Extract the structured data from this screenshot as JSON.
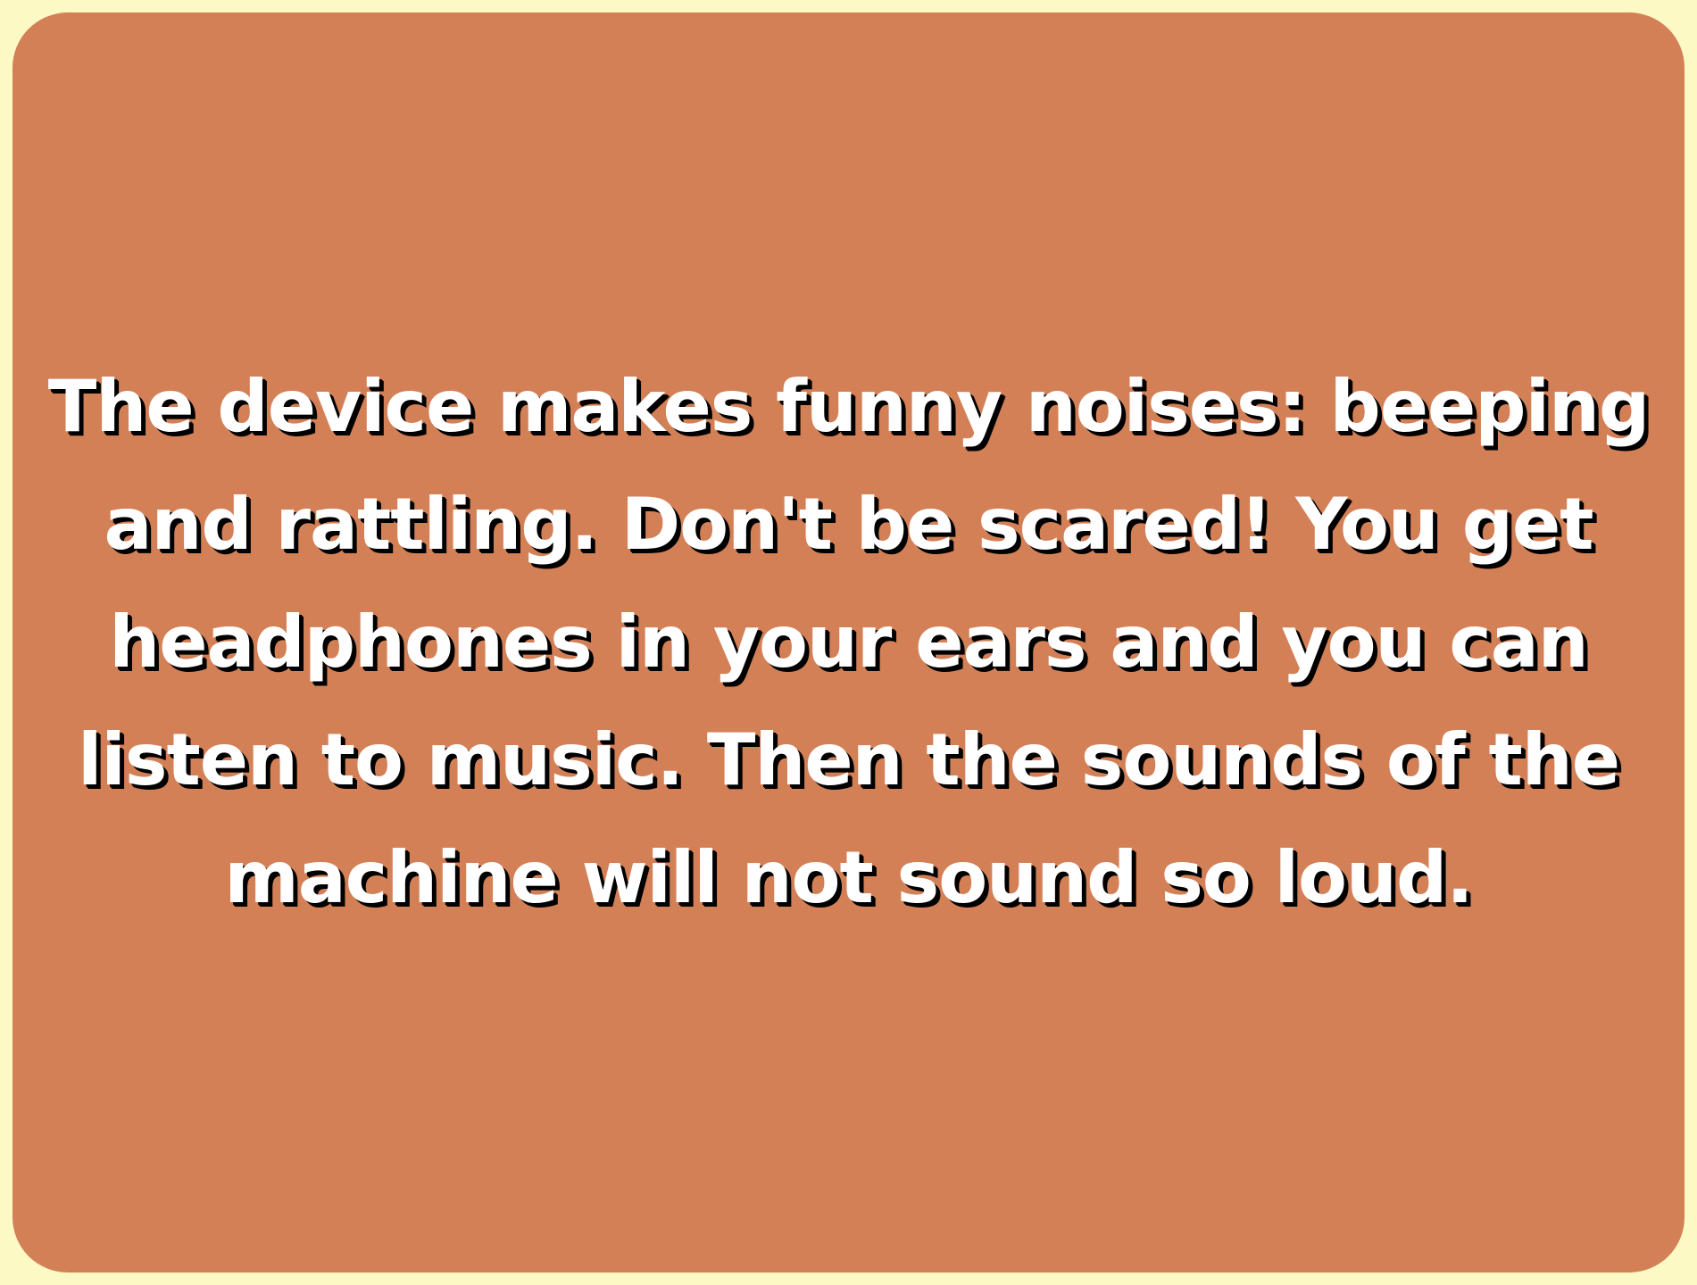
{
  "card": {
    "background_color": "#d38057",
    "border_color": "#fdf9c4",
    "text_color": "#ffffff",
    "shadow_color": "#000000",
    "lines": [
      "The device makes funny noises: beeping",
      "and rattling. Don't be scared! You get",
      "headphones in your ears and you can",
      "listen to music. Then the sounds of the",
      "machine will not sound so loud."
    ]
  }
}
